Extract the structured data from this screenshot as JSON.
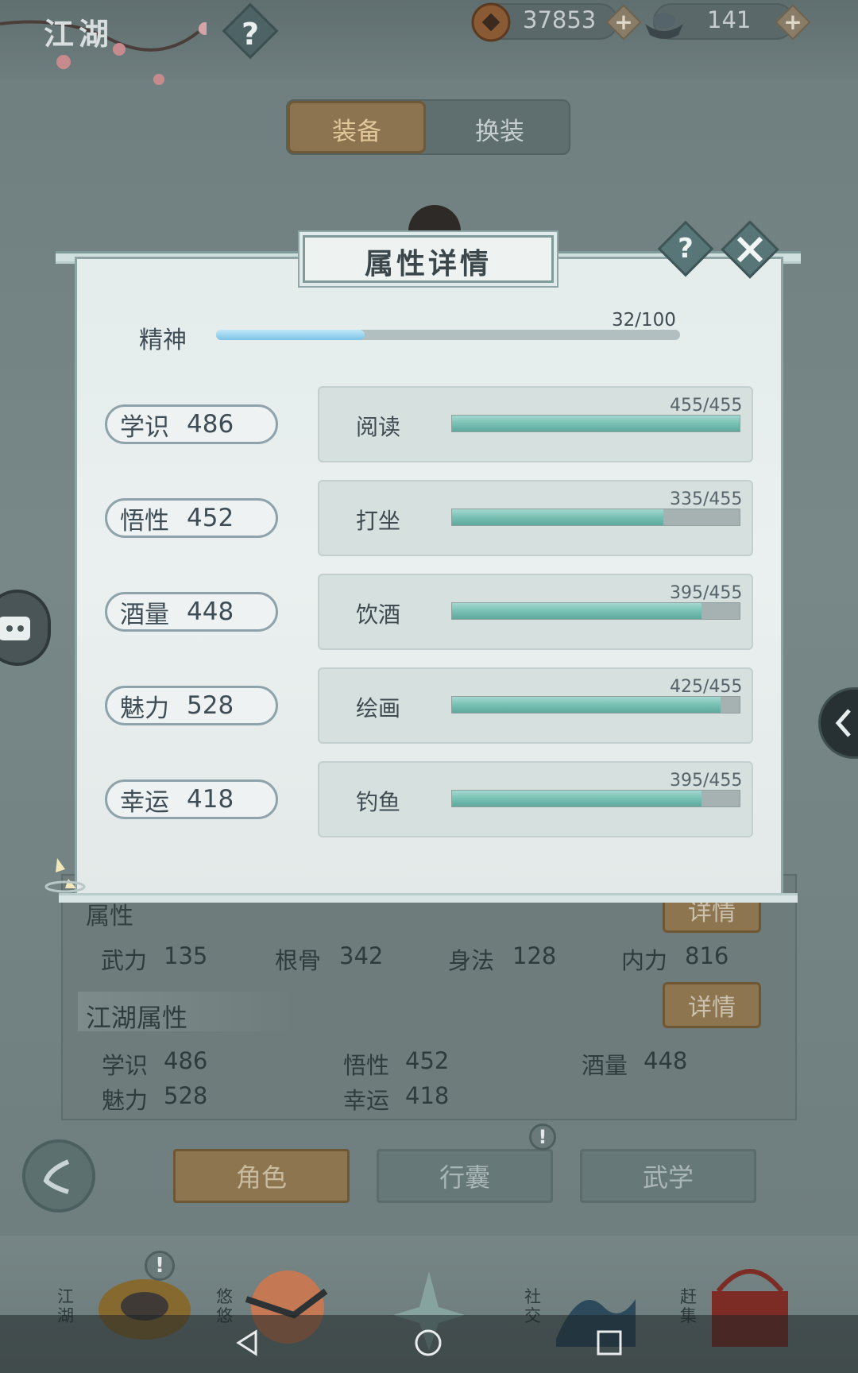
{
  "header": {
    "title": "江湖",
    "help_icon": "question-icon"
  },
  "resources": [
    {
      "icon": "copper-coin-icon",
      "value": "37853"
    },
    {
      "icon": "silver-ingot-icon",
      "value": "141"
    }
  ],
  "equip_tabs": {
    "items": [
      "装备",
      "换装"
    ],
    "active": 0
  },
  "modal": {
    "title": "属性详情",
    "spirit": {
      "label": "精神",
      "value": "32/100",
      "fraction": 0.32
    },
    "stats": [
      {
        "name": "学识",
        "value": "486",
        "skill": "阅读",
        "progress": "455/455",
        "fraction": 1.0
      },
      {
        "name": "悟性",
        "value": "452",
        "skill": "打坐",
        "progress": "335/455",
        "fraction": 0.736
      },
      {
        "name": "酒量",
        "value": "448",
        "skill": "饮酒",
        "progress": "395/455",
        "fraction": 0.868
      },
      {
        "name": "魅力",
        "value": "528",
        "skill": "绘画",
        "progress": "425/455",
        "fraction": 0.934
      },
      {
        "name": "幸运",
        "value": "418",
        "skill": "钓鱼",
        "progress": "395/455",
        "fraction": 0.868
      }
    ]
  },
  "panel": {
    "section1_title": "属性",
    "detail_label": "详情",
    "combat": [
      {
        "label": "武力",
        "value": "135"
      },
      {
        "label": "根骨",
        "value": "342"
      },
      {
        "label": "身法",
        "value": "128"
      },
      {
        "label": "内力",
        "value": "816"
      }
    ],
    "section2_title": "江湖属性",
    "jianghu": [
      {
        "label": "学识",
        "value": "486"
      },
      {
        "label": "悟性",
        "value": "452"
      },
      {
        "label": "酒量",
        "value": "448"
      },
      {
        "label": "魅力",
        "value": "528"
      },
      {
        "label": "幸运",
        "value": "418"
      }
    ]
  },
  "nav_buttons": [
    "角色",
    "行囊",
    "武学"
  ],
  "bottom_nav": [
    {
      "label": "江湖"
    },
    {
      "label": "悠悠"
    },
    {
      "label": ""
    },
    {
      "label": "社交"
    },
    {
      "label": "赶集"
    }
  ],
  "colors": {
    "accent_gold": "#8d7550",
    "bar_teal": "#78c0b3",
    "spirit_blue": "#86c9e8"
  }
}
